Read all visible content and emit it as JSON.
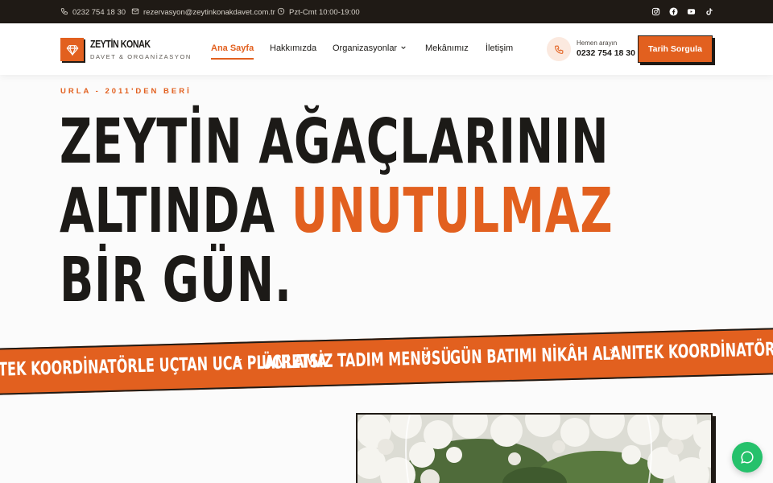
{
  "topbar": {
    "phone": "0232 754 18 30",
    "email": "rezervasyon@zeytinkonakdavet.com.tr",
    "hours": "Pzt-Cmt 10:00-19:00",
    "social_icons": [
      "instagram-icon",
      "facebook-icon",
      "youtube-icon",
      "tiktok-icon"
    ]
  },
  "brand": {
    "name": "ZEYTİN KONAK",
    "tagline": "DAVET & ORGANİZASYON"
  },
  "nav": {
    "items": [
      "Ana Sayfa",
      "Hakkımızda",
      "Organizasyonlar",
      "Mekânımız",
      "İletişim"
    ],
    "active": "Ana Sayfa"
  },
  "call": {
    "label": "Hemen arayın",
    "number": "0232 754 18 30"
  },
  "cta_label": "Tarih Sorgula",
  "hero": {
    "eyebrow": "URLA - 2011'DEN BERİ",
    "line1": "ZEYTİN AĞAÇLARININ",
    "line2_start": "ALTINDA ",
    "line2_accent": "UNUTULMAZ",
    "line3": "BİR GÜN."
  },
  "ribbon": {
    "items": [
      "TEK KOORDİNATÖRLE UÇTAN UCA PLANLAMA",
      "ÜCRETSİZ TADIM MENÜSÜ",
      "GÜN BATIMI NİKÂH ALANI",
      "TEK KOORDİNATÖRLE UÇTAN UCA PLANLAMA"
    ],
    "separator": "*"
  },
  "colors": {
    "accent": "#e2601f",
    "dark": "#1f1a15",
    "chat": "#25c16b"
  }
}
